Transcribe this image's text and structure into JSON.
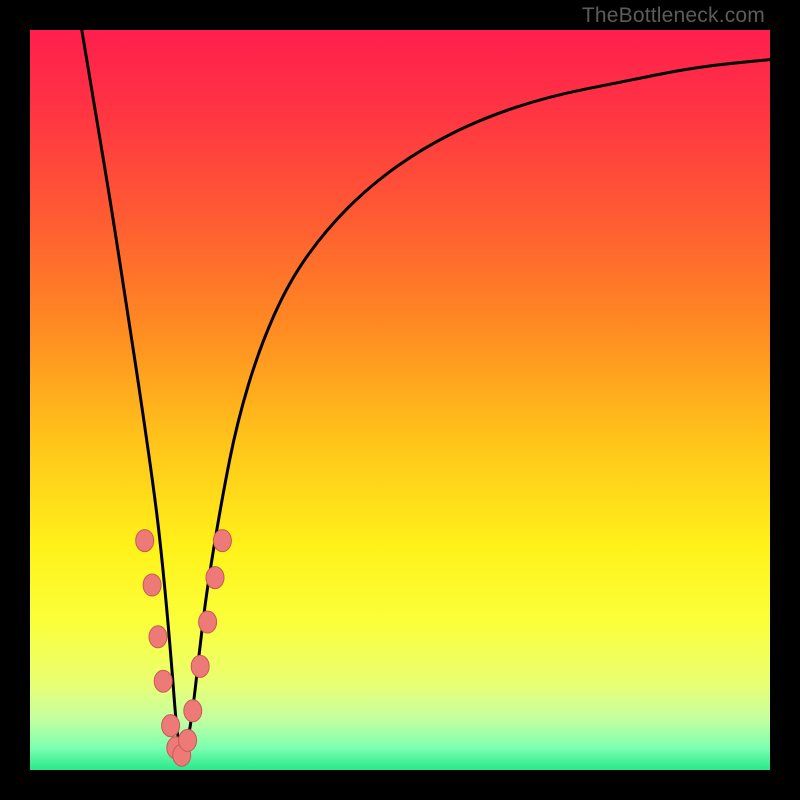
{
  "attribution": "TheBottleneck.com",
  "colors": {
    "frame": "#000000",
    "curve": "#000000",
    "marker_fill": "#ee7a78",
    "marker_stroke": "#c55a58",
    "gradient_stops": [
      {
        "offset": 0.0,
        "color": "#ff1f4d"
      },
      {
        "offset": 0.1,
        "color": "#ff3244"
      },
      {
        "offset": 0.25,
        "color": "#ff5a33"
      },
      {
        "offset": 0.4,
        "color": "#ff8a22"
      },
      {
        "offset": 0.55,
        "color": "#ffc21a"
      },
      {
        "offset": 0.7,
        "color": "#fff21a"
      },
      {
        "offset": 0.8,
        "color": "#fbff3a"
      },
      {
        "offset": 0.88,
        "color": "#eaff70"
      },
      {
        "offset": 0.93,
        "color": "#c6ffa0"
      },
      {
        "offset": 0.97,
        "color": "#7dffb0"
      },
      {
        "offset": 1.0,
        "color": "#28e88b"
      }
    ]
  },
  "chart_data": {
    "type": "line",
    "title": "",
    "xlabel": "",
    "ylabel": "",
    "xlim": [
      0,
      100
    ],
    "ylim": [
      0,
      100
    ],
    "notes": "Bottleneck-percentage style curve. x ~ component balance position (0-100). y ~ bottleneck % (0 best at bottom, 100 worst at top). Deep V with minimum near x≈20. Salmon markers cluster around the valley (bottom ~30% of y). Values estimated from pixels.",
    "series": [
      {
        "name": "bottleneck-curve",
        "x": [
          7,
          9,
          11,
          13,
          15,
          17,
          18,
          19,
          20,
          21,
          22,
          23,
          24,
          26,
          28,
          31,
          35,
          40,
          46,
          53,
          61,
          70,
          80,
          90,
          100
        ],
        "y": [
          100,
          88,
          76,
          63,
          50,
          36,
          27,
          16,
          3,
          2,
          8,
          17,
          25,
          37,
          47,
          57,
          66,
          73,
          79,
          84,
          88,
          91,
          93,
          95,
          96
        ]
      }
    ],
    "markers": [
      {
        "x": 15.5,
        "y": 31
      },
      {
        "x": 16.5,
        "y": 25
      },
      {
        "x": 17.3,
        "y": 18
      },
      {
        "x": 18.0,
        "y": 12
      },
      {
        "x": 19.0,
        "y": 6
      },
      {
        "x": 19.7,
        "y": 3
      },
      {
        "x": 20.5,
        "y": 2
      },
      {
        "x": 21.3,
        "y": 4
      },
      {
        "x": 22.0,
        "y": 8
      },
      {
        "x": 23.0,
        "y": 14
      },
      {
        "x": 24.0,
        "y": 20
      },
      {
        "x": 25.0,
        "y": 26
      },
      {
        "x": 26.0,
        "y": 31
      }
    ]
  }
}
